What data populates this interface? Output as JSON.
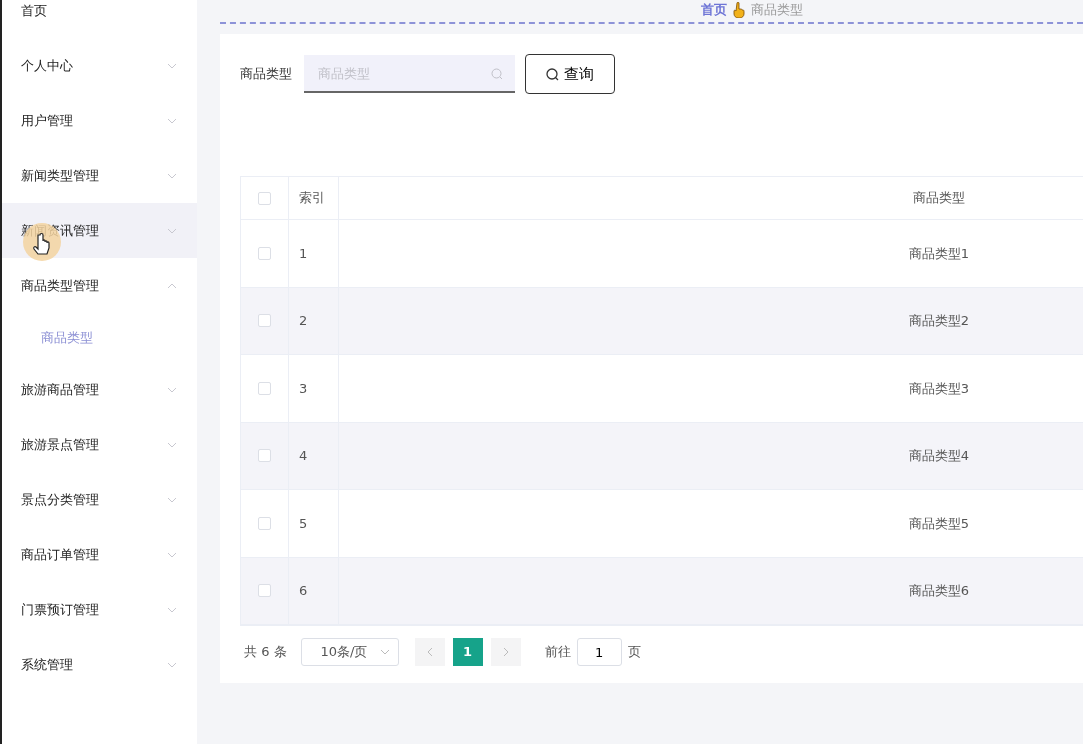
{
  "sidebar": {
    "items": [
      {
        "label": "首页",
        "kind": "link"
      },
      {
        "label": "个人中心",
        "kind": "submenu",
        "expanded": false,
        "hovered": false
      },
      {
        "label": "用户管理",
        "kind": "submenu",
        "expanded": false,
        "hovered": false
      },
      {
        "label": "新闻类型管理",
        "kind": "submenu",
        "expanded": false,
        "hovered": false
      },
      {
        "label": "新闻资讯管理",
        "kind": "submenu",
        "expanded": false,
        "hovered": true
      },
      {
        "label": "商品类型管理",
        "kind": "submenu",
        "expanded": true,
        "hovered": false,
        "children": [
          {
            "label": "商品类型",
            "selected": true
          }
        ]
      },
      {
        "label": "旅游商品管理",
        "kind": "submenu",
        "expanded": false,
        "hovered": false
      },
      {
        "label": "旅游景点管理",
        "kind": "submenu",
        "expanded": false,
        "hovered": false
      },
      {
        "label": "景点分类管理",
        "kind": "submenu",
        "expanded": false,
        "hovered": false
      },
      {
        "label": "商品订单管理",
        "kind": "submenu",
        "expanded": false,
        "hovered": false
      },
      {
        "label": "门票预订管理",
        "kind": "submenu",
        "expanded": false,
        "hovered": false
      },
      {
        "label": "系统管理",
        "kind": "submenu",
        "expanded": false,
        "hovered": false
      }
    ]
  },
  "breadcrumb": [
    {
      "label": "首页",
      "current": false
    },
    {
      "label": "商品类型",
      "current": true
    }
  ],
  "search": {
    "label": "商品类型",
    "placeholder": "商品类型",
    "button": "查询"
  },
  "table": {
    "all_checked": false,
    "columns": [
      "索引",
      "商品类型"
    ],
    "rows": [
      {
        "cells": [
          "1",
          "商品类型1"
        ],
        "checked": false
      },
      {
        "cells": [
          "2",
          "商品类型2"
        ],
        "checked": false
      },
      {
        "cells": [
          "3",
          "商品类型3"
        ],
        "checked": false
      },
      {
        "cells": [
          "4",
          "商品类型4"
        ],
        "checked": false
      },
      {
        "cells": [
          "5",
          "商品类型5"
        ],
        "checked": false
      },
      {
        "cells": [
          "6",
          "商品类型6"
        ],
        "checked": false
      }
    ]
  },
  "pagination": {
    "total": "共 6 条",
    "page_size": "10条/页",
    "pages": [
      {
        "label": "1",
        "selected": true
      }
    ],
    "goto_label": "前往",
    "goto_value": "1",
    "page_unit": "页"
  }
}
